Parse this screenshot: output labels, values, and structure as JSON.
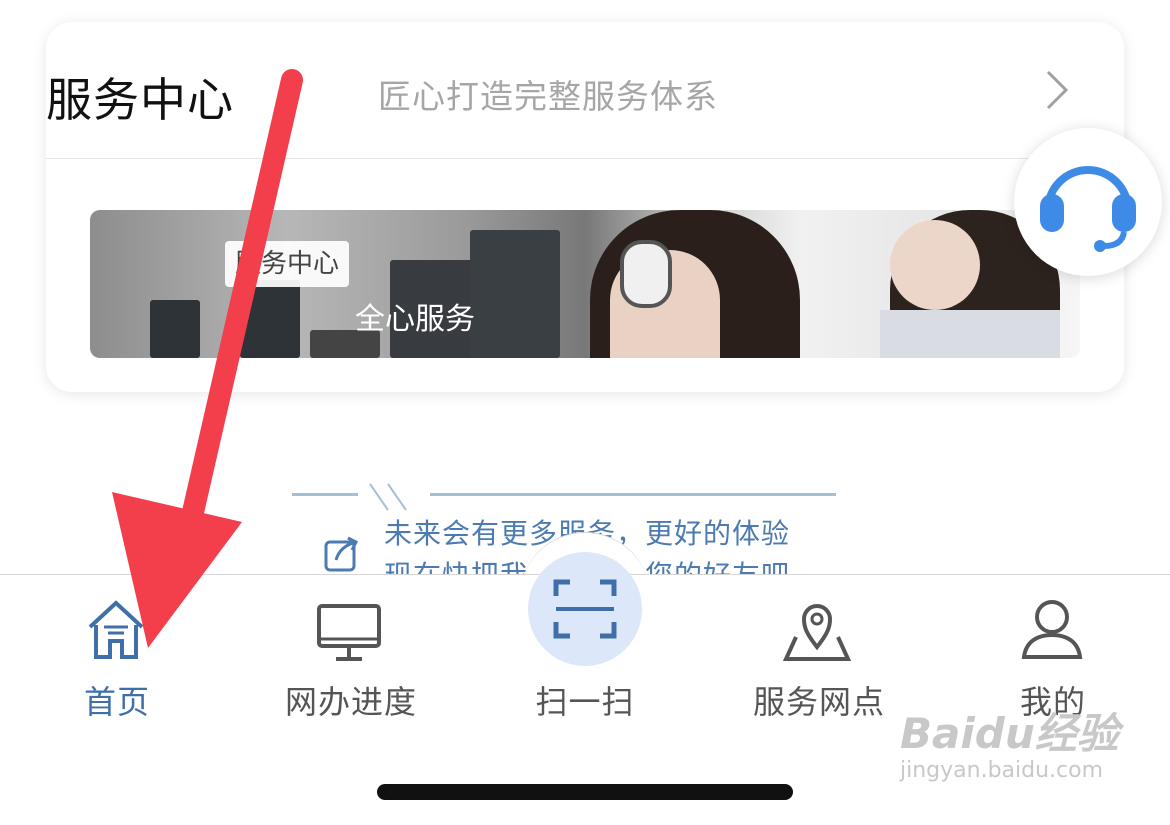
{
  "service_card": {
    "title": "服务中心",
    "subtitle": "匠心打造完整服务体系",
    "banner_tag": "服务中心",
    "banner_text": "全心服务"
  },
  "support_button": {
    "icon": "headset-icon"
  },
  "promo": {
    "line1": "未来会有更多服务，更好的体验",
    "line2": "现在快把我们推荐给您的好友吧",
    "icon": "share-icon"
  },
  "tabbar": {
    "tabs": [
      {
        "label": "首页",
        "icon": "home-icon",
        "active": true
      },
      {
        "label": "网办进度",
        "icon": "monitor-icon",
        "active": false
      },
      {
        "label": "扫一扫",
        "icon": "scan-icon",
        "active": false
      },
      {
        "label": "服务网点",
        "icon": "map-pin-icon",
        "active": false
      },
      {
        "label": "我的",
        "icon": "user-icon",
        "active": false
      }
    ]
  },
  "watermark": {
    "brand": "Baidu经验",
    "url": "jingyan.baidu.com"
  },
  "colors": {
    "accent": "#3f6fa8",
    "arrow": "#f23f4b",
    "fab_icon": "#3d8be6"
  }
}
